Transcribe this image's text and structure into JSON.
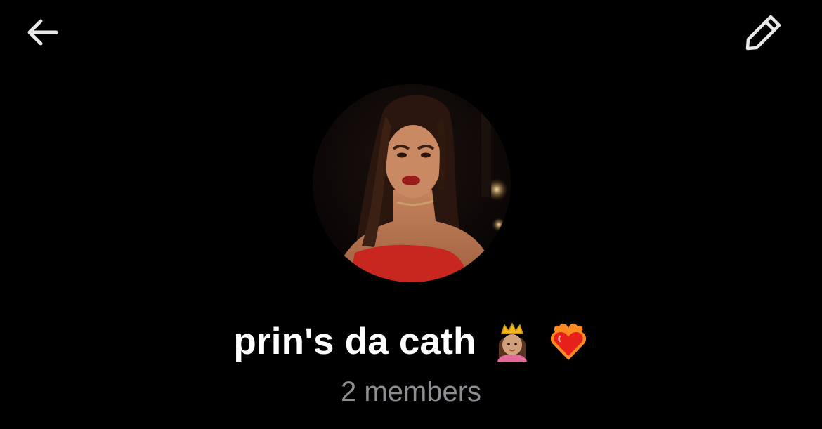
{
  "header": {
    "back_icon": "arrow-left-icon",
    "edit_icon": "pencil-icon"
  },
  "group": {
    "name": "prin's da cath",
    "emoji_1": "princess-emoji",
    "emoji_2": "heart-on-fire-emoji",
    "members_text": "2 members"
  },
  "colors": {
    "background": "#000000",
    "text_primary": "#ffffff",
    "text_secondary": "#8d8f93",
    "icon": "#e7e9ea",
    "avatar_dress": "#c8271f"
  }
}
